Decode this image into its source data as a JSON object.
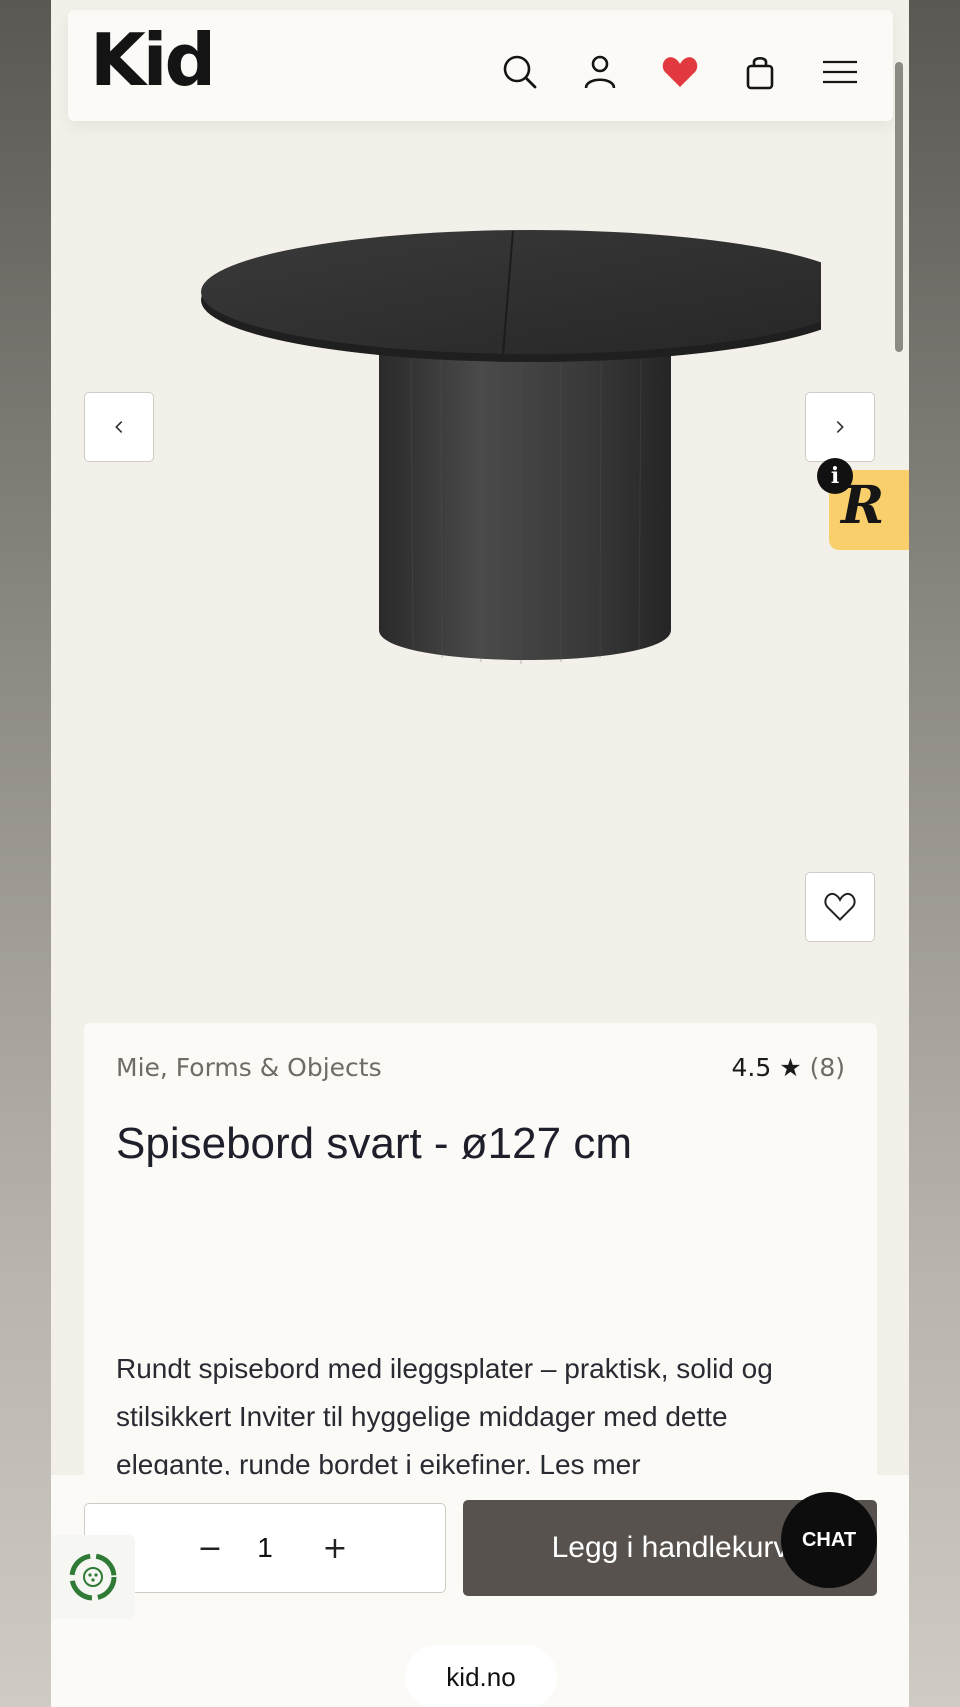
{
  "header": {
    "logo": "Kid",
    "icons": [
      "search-icon",
      "account-icon",
      "heart-icon",
      "bag-icon",
      "menu-icon"
    ],
    "heart_color": "#e2383f"
  },
  "gallery": {
    "prev_icon": "chevron-left-icon",
    "next_icon": "chevron-right-icon",
    "favorite_icon": "heart-outline-icon",
    "widget_badge": "R",
    "widget_info": "i"
  },
  "product": {
    "brand": "Mie, Forms & Objects",
    "rating": "4.5",
    "rating_count": "(8)",
    "title": "Spisebord svart - ø127 cm",
    "description": "Rundt spisebord med ileggsplater – praktisk, solid og stilsikkert Inviter til hyggelige middager med dette elegante, runde bordet i eikefiner.",
    "read_more": "Les mer"
  },
  "cart": {
    "quantity": "1",
    "minus": "−",
    "plus": "+",
    "add_label": "Legg i handlekurv",
    "chat_label": "CHAT"
  },
  "browser": {
    "url": "kid.no"
  },
  "colors": {
    "page_bg": "#f3f0ea",
    "card_bg": "#fbfaf6",
    "button_bg": "#57524d",
    "badge_yellow": "#f9cf6c"
  }
}
